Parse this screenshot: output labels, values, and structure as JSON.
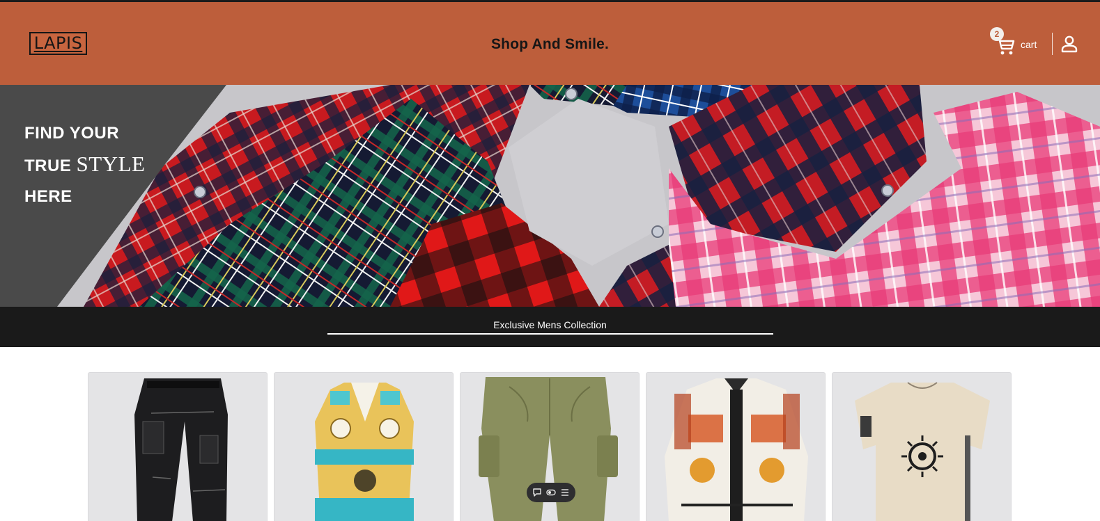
{
  "header": {
    "logo_text": "LAPIS",
    "tagline": "Shop And Smile.",
    "cart": {
      "count": "2",
      "label": "cart",
      "icon": "cart-icon"
    },
    "account": {
      "icon": "user-icon"
    }
  },
  "hero": {
    "line1": "FIND YOUR",
    "line2_prefix": "TRUE ",
    "line2_emphasis": "STYLE",
    "line3": "HERE",
    "image": "plaid shirts collage"
  },
  "collection": {
    "title": "Exclusive Mens Collection"
  },
  "products": [
    {
      "image": "black cargo pants"
    },
    {
      "image": "baroque print robe"
    },
    {
      "image": "olive cargo pants"
    },
    {
      "image": "baroque print long sleeve shirt"
    },
    {
      "image": "beige sun print t-shirt"
    }
  ],
  "toolbar": {
    "icons": [
      "comment-icon",
      "toggle-icon",
      "menu-icon"
    ]
  },
  "colors": {
    "header_bg": "#bd5e3b",
    "hero_panel": "#4a4a4a",
    "collection_bar": "#1a1a1a",
    "card_bg": "#e4e4e6"
  }
}
